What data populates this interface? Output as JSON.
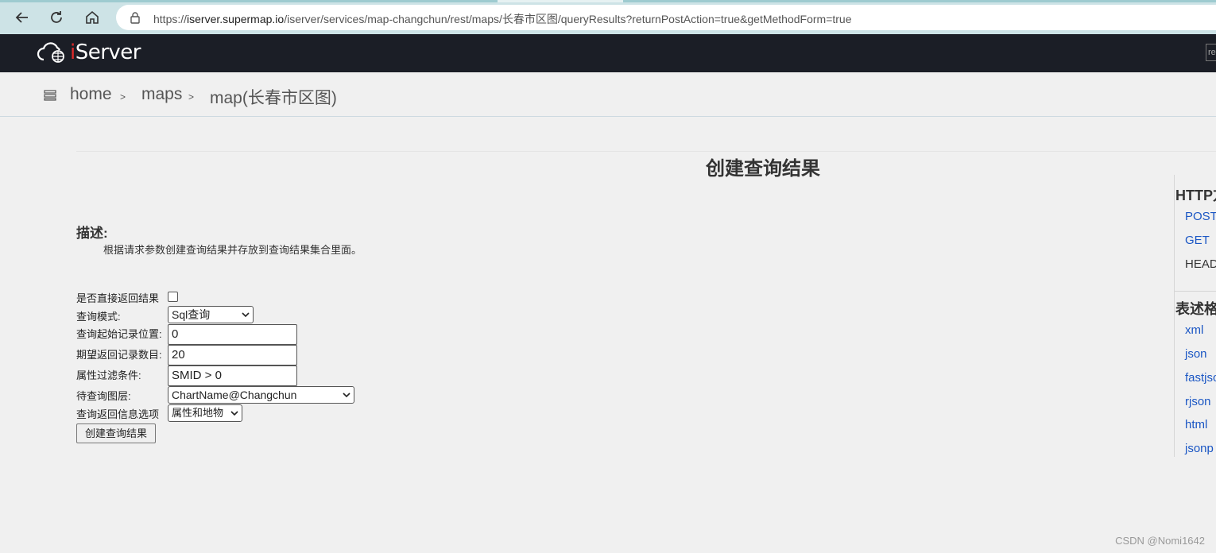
{
  "browser": {
    "url_prefix": "https://",
    "url_host": "iserver.supermap.io",
    "url_path": "/iserver/services/map-changchun/rest/maps/长春市区图/queryResults?returnPostAction=true&getMethodForm=true"
  },
  "header": {
    "logo_text_i": "i",
    "logo_text_rest": "Server",
    "edge_box_text": "re"
  },
  "breadcrumb": {
    "items": [
      "home",
      "maps",
      "map(长春市区图)"
    ],
    "separator": ">"
  },
  "page": {
    "title": "创建查询结果",
    "description_label": "描述:",
    "description_text": "根据请求参数创建查询结果并存放到查询结果集合里面。"
  },
  "form": {
    "return_directly_label": "是否直接返回结果",
    "query_mode_label": "查询模式:",
    "query_mode_value": "Sql查询",
    "start_record_label": "查询起始记录位置:",
    "start_record_value": "0",
    "expect_count_label": "期望返回记录数目:",
    "expect_count_value": "20",
    "attribute_filter_label": "属性过滤条件:",
    "attribute_filter_value": "SMID > 0",
    "layer_label": "待查询图层:",
    "layer_value": "ChartName@Changchun",
    "return_option_label": "查询返回信息选项",
    "return_option_value": "属性和地物",
    "submit_label": "创建查询结果"
  },
  "side_panel": {
    "http_title": "HTTP方",
    "methods": [
      "POST",
      "GET",
      "HEAD"
    ],
    "format_title": "表述格",
    "formats": [
      "xml",
      "json",
      "fastjson",
      "rjson",
      "html",
      "jsonp"
    ]
  },
  "watermark": "CSDN @Nomi1642"
}
